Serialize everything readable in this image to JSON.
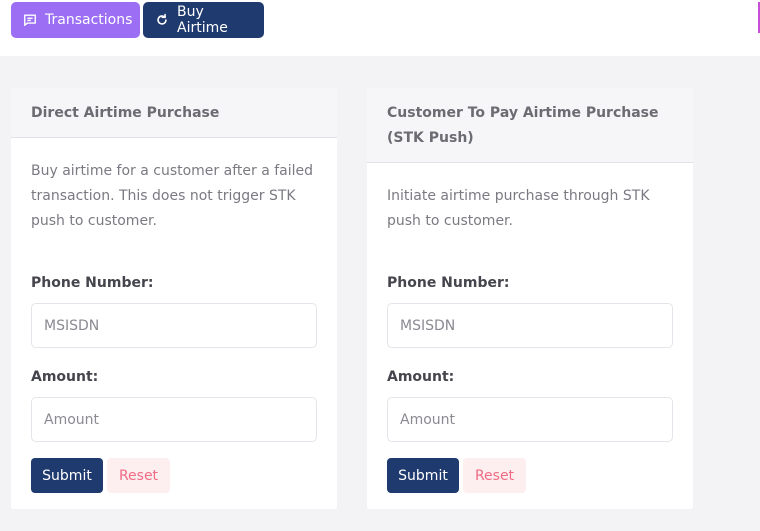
{
  "topbar": {
    "transactions_label": "Transactions",
    "buy_airtime_label": "Buy Airtime"
  },
  "cards": [
    {
      "title": "Direct Airtime Purchase",
      "description": "Buy airtime for a customer after a failed transaction. This does not trigger STK push to customer.",
      "phone_label": "Phone Number:",
      "phone_placeholder": "MSISDN",
      "amount_label": "Amount:",
      "amount_placeholder": "Amount",
      "submit_label": "Submit",
      "reset_label": "Reset"
    },
    {
      "title": "Customer To Pay Airtime Purchase (STK Push)",
      "description": "Initiate airtime purchase through STK push to customer.",
      "phone_label": "Phone Number:",
      "phone_placeholder": "MSISDN",
      "amount_label": "Amount:",
      "amount_placeholder": "Amount",
      "submit_label": "Submit",
      "reset_label": "Reset"
    }
  ],
  "colors": {
    "primary": "#1f3a6e",
    "accent_purple": "#9b6ef3",
    "reset_bg": "#fdeef0",
    "reset_text": "#f06b84"
  },
  "icons": {
    "transactions": "message-square-icon",
    "buy_airtime": "redo-arrow-icon"
  }
}
